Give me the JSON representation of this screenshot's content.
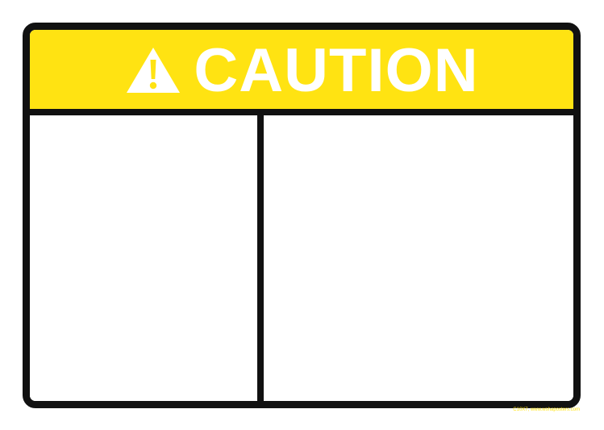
{
  "sign": {
    "header_text": "CAUTION",
    "header_icon": "warning-triangle-icon",
    "left_panel_text": "",
    "right_panel_text": ""
  },
  "footer": {
    "credit": "C10X7, www.wshaposters.com"
  },
  "colors": {
    "header_background": "#FFE312",
    "header_text": "#FFFFFF",
    "border": "#111111",
    "panel_background": "#FFFFFF",
    "credit_text": "#FFE312"
  }
}
